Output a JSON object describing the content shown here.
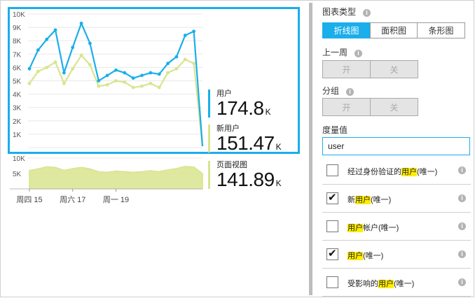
{
  "chart_data": [
    {
      "type": "line",
      "series": [
        {
          "name": "用户",
          "color": "#1aaeea",
          "values": [
            5.9,
            7.3,
            8.1,
            8.8,
            5.6,
            7.5,
            9.3,
            7.8,
            5.0,
            5.4,
            5.8,
            5.6,
            5.2,
            5.4,
            5.6,
            5.5,
            6.3,
            6.8,
            8.4,
            8.7,
            0.1
          ]
        },
        {
          "name": "新用户",
          "color": "#d9e48e",
          "values": [
            4.8,
            5.7,
            6.0,
            6.4,
            4.8,
            5.9,
            6.9,
            6.2,
            4.6,
            4.7,
            5.0,
            4.9,
            4.5,
            4.6,
            4.8,
            4.5,
            5.6,
            5.9,
            6.6,
            6.3,
            0.1
          ]
        }
      ],
      "y_ticks": [
        "10K",
        "9K",
        "8K",
        "7K",
        "6K",
        "5K",
        "4K",
        "3K",
        "2K",
        "1K"
      ],
      "ylim": [
        0,
        10
      ]
    },
    {
      "type": "area",
      "series": [
        {
          "name": "页面视图",
          "color": "#d9e48e",
          "values": [
            6.0,
            6.5,
            7.2,
            7.0,
            6.0,
            6.6,
            7.0,
            6.5,
            5.6,
            5.4,
            5.8,
            5.6,
            5.4,
            5.6,
            5.9,
            5.6,
            6.2,
            6.6,
            7.3,
            7.1,
            5.0
          ]
        }
      ],
      "y_ticks": [
        "10K",
        "5K"
      ],
      "ylim": [
        0,
        10
      ]
    }
  ],
  "x_axis_labels": [
    "周四 15",
    "周六 17",
    "周一 19"
  ],
  "metrics": [
    {
      "label": "用户",
      "value": "174.8",
      "unit": "K",
      "color": "#1aaeea"
    },
    {
      "label": "新用户",
      "value": "151.47",
      "unit": "K",
      "color": "#d9e48e"
    },
    {
      "label": "页面视图",
      "value": "141.89",
      "unit": "K",
      "color": "#d9e48e"
    }
  ],
  "panel": {
    "chart_type_title": "图表类型",
    "chart_types": [
      "折线图",
      "面积图",
      "条形图"
    ],
    "last_week_title": "上一周",
    "group_title": "分组",
    "on_label": "开",
    "off_label": "关",
    "metric_value_title": "度量值",
    "metric_input_value": "user",
    "info_glyph": "i",
    "options": [
      {
        "pre": "经过身份验证的",
        "hl": "用户",
        "post": "(唯一)",
        "checked": false
      },
      {
        "pre": "新",
        "hl": "用户",
        "post": "(唯一)",
        "checked": true
      },
      {
        "pre": "",
        "hl": "用户",
        "post": "帐户(唯一)",
        "checked": false
      },
      {
        "pre": "",
        "hl": "用户",
        "post": "(唯一)",
        "checked": true
      },
      {
        "pre": "受影响的",
        "hl": "用户",
        "post": "(唯一)",
        "checked": false
      }
    ],
    "check_glyph": "✔"
  }
}
